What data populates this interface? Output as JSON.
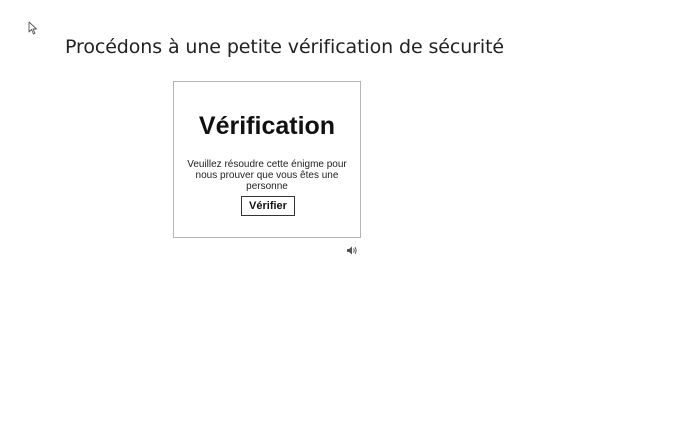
{
  "page": {
    "title": "Procédons à une petite vérification de sécurité"
  },
  "captcha": {
    "heading": "Vérification",
    "instructions": "Veuillez résoudre cette énigme pour nous prouver que vous êtes une personne",
    "verify_label": "Vérifier",
    "audio_icon": "speaker-icon"
  },
  "cursor_icon": "mouse-pointer-icon"
}
